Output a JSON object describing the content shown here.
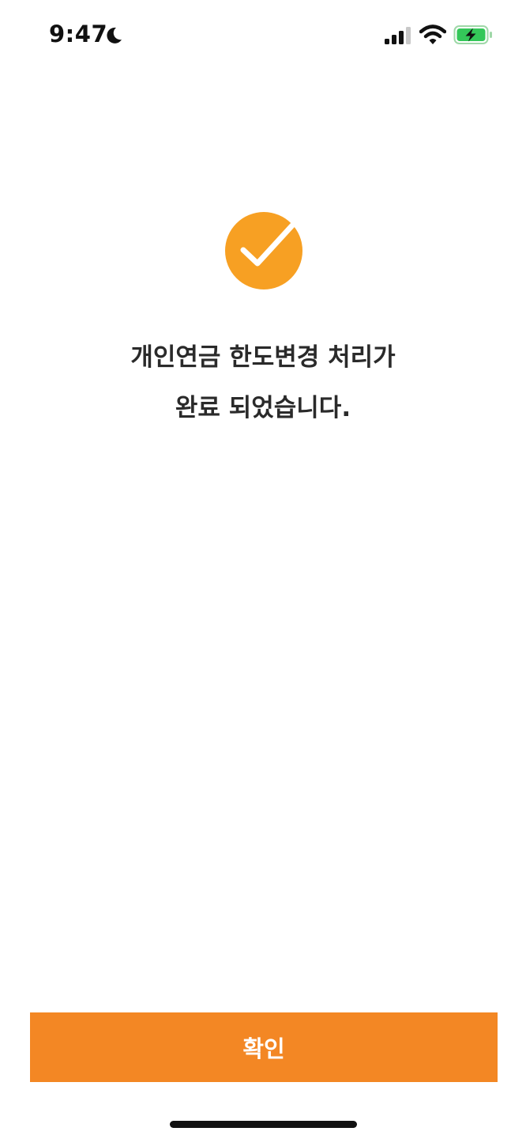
{
  "status_bar": {
    "time": "9:47",
    "icons": [
      "moon-icon",
      "cellular-signal-icon",
      "wifi-icon",
      "battery-charging-icon"
    ],
    "battery_color": "#34c759"
  },
  "success": {
    "icon": "check-circle-icon",
    "icon_color": "#f7a023",
    "message_line1": "개인연금 한도변경 처리가",
    "message_line2": "완료 되었습니다."
  },
  "actions": {
    "confirm_label": "확인",
    "accent_color": "#f38724"
  }
}
